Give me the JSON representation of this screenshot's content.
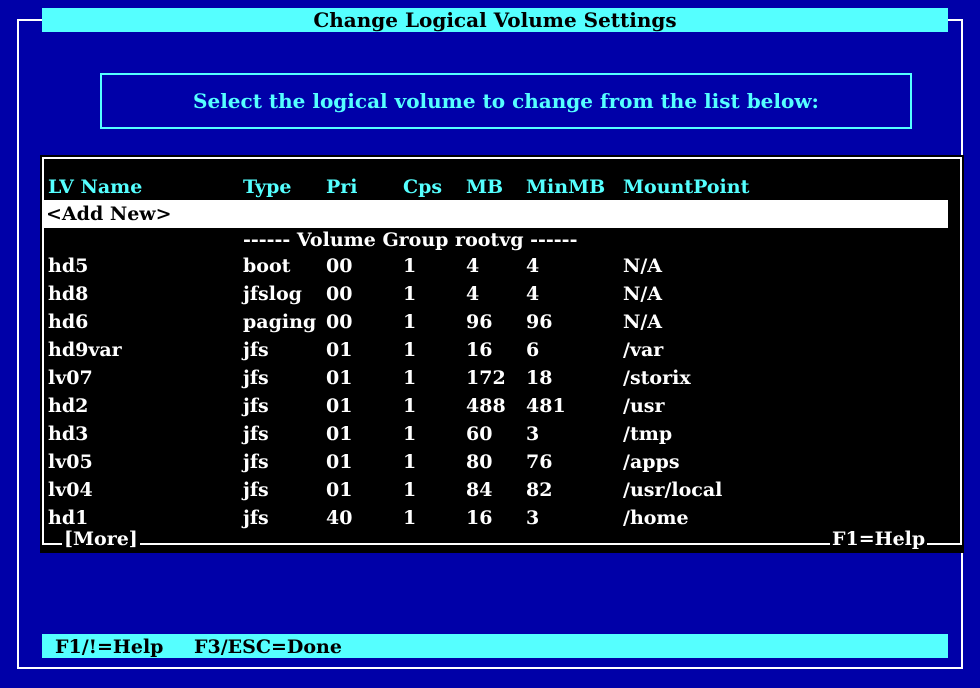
{
  "title": "Change Logical Volume Settings",
  "prompt": "Select the logical volume to change from the list below:",
  "columns": {
    "name": "LV Name",
    "type": "Type",
    "pri": "Pri",
    "cps": "Cps",
    "mb": "MB",
    "minmb": "MinMB",
    "mount": "MountPoint"
  },
  "add_new": "<Add New>",
  "group_separator": "------ Volume Group rootvg ------",
  "rows": [
    {
      "name": "hd5",
      "type": "boot",
      "pri": "00",
      "cps": "1",
      "mb": "4",
      "minmb": "4",
      "mount": "N/A"
    },
    {
      "name": "hd8",
      "type": "jfslog",
      "pri": "00",
      "cps": "1",
      "mb": "4",
      "minmb": "4",
      "mount": "N/A"
    },
    {
      "name": "hd6",
      "type": "paging",
      "pri": "00",
      "cps": "1",
      "mb": "96",
      "minmb": "96",
      "mount": "N/A"
    },
    {
      "name": "hd9var",
      "type": "jfs",
      "pri": "01",
      "cps": "1",
      "mb": "16",
      "minmb": "6",
      "mount": "/var"
    },
    {
      "name": "lv07",
      "type": "jfs",
      "pri": "01",
      "cps": "1",
      "mb": "172",
      "minmb": "18",
      "mount": "/storix"
    },
    {
      "name": "hd2",
      "type": "jfs",
      "pri": "01",
      "cps": "1",
      "mb": "488",
      "minmb": "481",
      "mount": "/usr"
    },
    {
      "name": "hd3",
      "type": "jfs",
      "pri": "01",
      "cps": "1",
      "mb": "60",
      "minmb": "3",
      "mount": "/tmp"
    },
    {
      "name": "lv05",
      "type": "jfs",
      "pri": "01",
      "cps": "1",
      "mb": "80",
      "minmb": "76",
      "mount": "/apps"
    },
    {
      "name": "lv04",
      "type": "jfs",
      "pri": "01",
      "cps": "1",
      "mb": "84",
      "minmb": "82",
      "mount": "/usr/local"
    },
    {
      "name": "hd1",
      "type": "jfs",
      "pri": "40",
      "cps": "1",
      "mb": "16",
      "minmb": "3",
      "mount": "/home"
    }
  ],
  "more_label": "[More]",
  "help_label": "F1=Help",
  "status": {
    "help": "F1/!=Help",
    "done": "F3/ESC=Done"
  }
}
